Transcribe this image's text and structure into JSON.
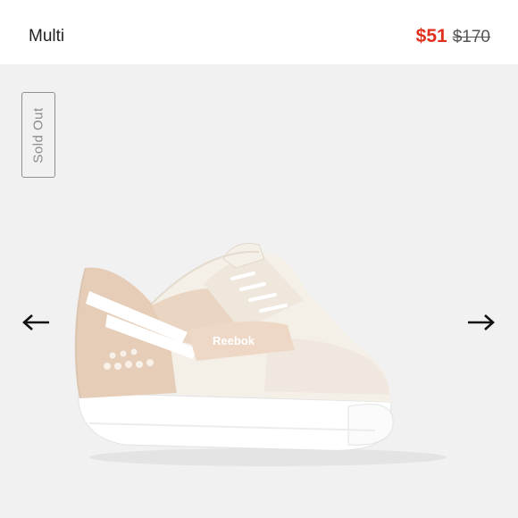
{
  "header": {
    "variant_label": "Multi",
    "price_sale": "$51",
    "price_original": "$170"
  },
  "badge": {
    "label": "Sold Out"
  },
  "product_image": {
    "logo_text": "Reebok"
  },
  "carousel": {
    "prev_icon": "arrow-left-icon",
    "next_icon": "arrow-right-icon"
  },
  "colors": {
    "sale_price": "#e0301e",
    "background": "#f1f1f1",
    "shoe_cream": "#f4efe7",
    "shoe_tan": "#e6cdb8"
  }
}
